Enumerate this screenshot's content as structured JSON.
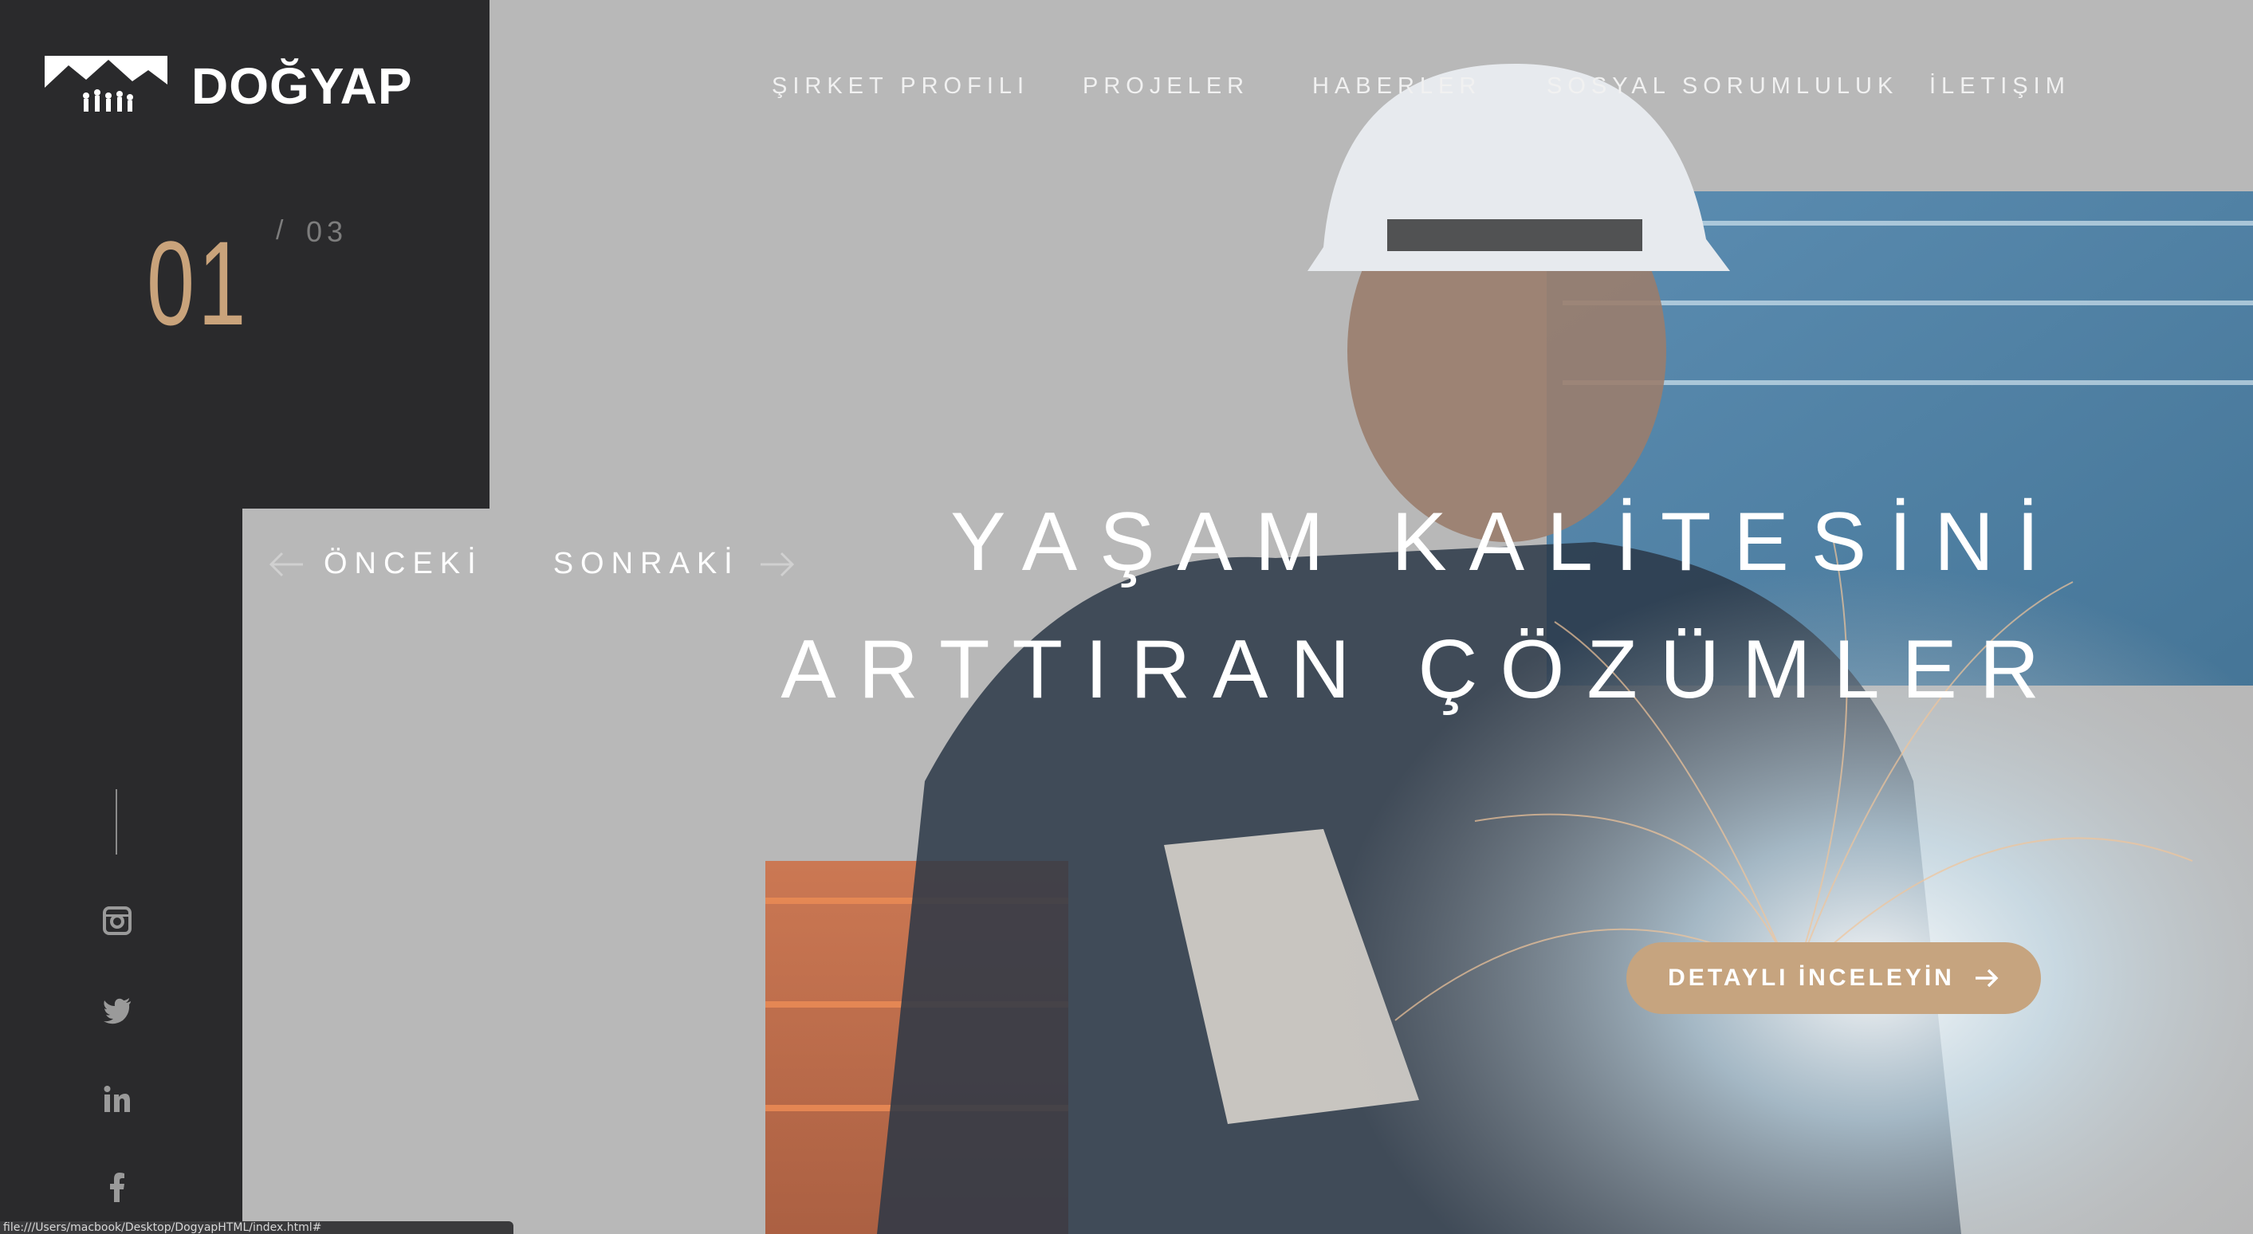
{
  "brand": {
    "name": "DOĞYAP"
  },
  "slider": {
    "current": "01",
    "separator": "/",
    "total": "03",
    "prev_label": "ÖNCEKİ",
    "next_label": "SONRAKİ"
  },
  "nav": {
    "items": [
      {
        "label": "ŞIRKET PROFILI"
      },
      {
        "label": "PROJELER"
      },
      {
        "label": "HABERLER"
      },
      {
        "label": "SOSYAL SORUMLULUK"
      },
      {
        "label": "İLETIŞIM"
      }
    ]
  },
  "hero": {
    "line1": "YAŞAM KALİTESİNİ",
    "line2": "ARTTIRAN ÇÖZÜMLER",
    "cta_label": "DETAYLI İNCELEYİN"
  },
  "social": [
    "instagram-icon",
    "twitter-icon",
    "linkedin-icon",
    "facebook-icon"
  ],
  "status_bar": {
    "url": "file:///Users/macbook/Desktop/DogyapHTML/index.html#"
  },
  "colors": {
    "panel": "#2a2a2c",
    "accent": "#c6a47f",
    "page_bg": "#b9b9b9"
  }
}
